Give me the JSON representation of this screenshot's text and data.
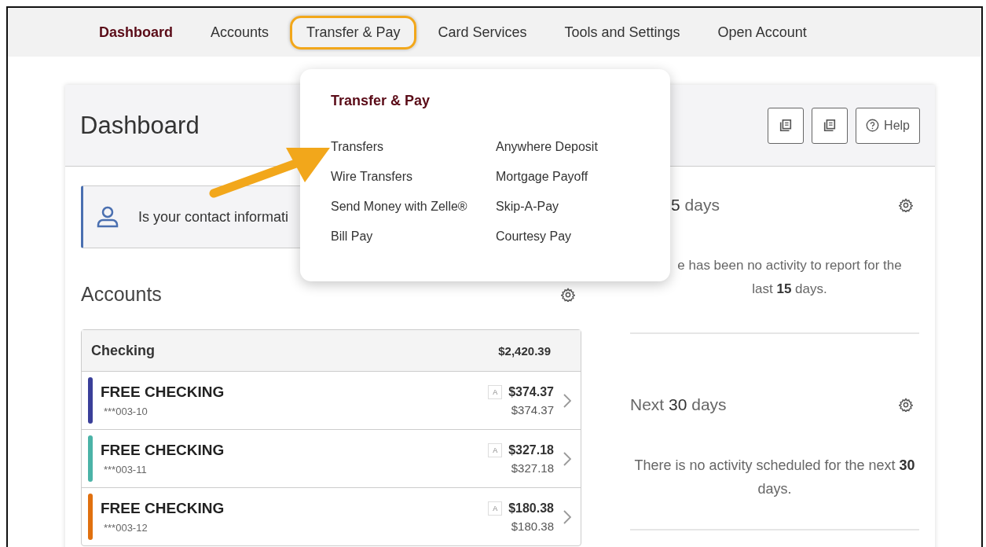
{
  "nav": [
    {
      "label": "Dashboard",
      "selected": true,
      "highlighted": false
    },
    {
      "label": "Accounts",
      "selected": false,
      "highlighted": false
    },
    {
      "label": "Transfer & Pay",
      "selected": false,
      "highlighted": true
    },
    {
      "label": "Card Services",
      "selected": false,
      "highlighted": false
    },
    {
      "label": "Tools and Settings",
      "selected": false,
      "highlighted": false
    },
    {
      "label": "Open Account",
      "selected": false,
      "highlighted": false
    }
  ],
  "dropdown": {
    "title": "Transfer & Pay",
    "columns": [
      [
        "Transfers",
        "Wire Transfers",
        "Send Money with Zelle®",
        "Bill Pay"
      ],
      [
        "Anywhere Deposit",
        "Mortgage Payoff",
        "Skip-A-Pay",
        "Courtesy Pay"
      ]
    ]
  },
  "page_title": "Dashboard",
  "header_buttons": [
    {
      "kind": "icon"
    },
    {
      "kind": "icon"
    },
    {
      "kind": "help",
      "label": "Help"
    }
  ],
  "contact_banner": "Is your contact informati",
  "accounts": {
    "title": "Accounts",
    "group": {
      "name": "Checking",
      "total": "$2,420.39"
    },
    "rows": [
      {
        "name": "FREE CHECKING",
        "number": "***003-10",
        "badge": "A",
        "balance": "$374.37",
        "available": "$374.37",
        "color": "#3a3f99"
      },
      {
        "name": "FREE CHECKING",
        "number": "***003-11",
        "badge": "A",
        "balance": "$327.18",
        "available": "$327.18",
        "color": "#4bb3a7"
      },
      {
        "name": "FREE CHECKING",
        "number": "***003-12",
        "badge": "A",
        "balance": "$180.38",
        "available": "$180.38",
        "color": "#e0700f"
      }
    ]
  },
  "activity": [
    {
      "heading": "**5** days",
      "message": "e has been no activity to report for the last **15** days."
    },
    {
      "heading": "Next **30** days",
      "message": "There is no activity scheduled for the next **30** days."
    }
  ]
}
